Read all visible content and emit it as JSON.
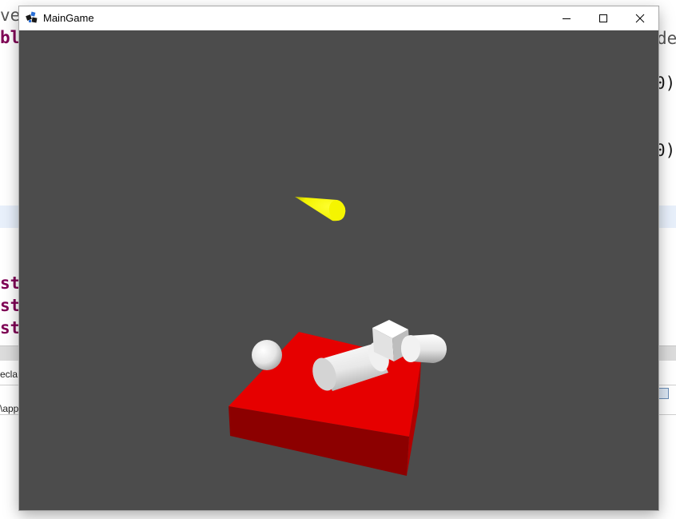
{
  "window": {
    "title": "MainGame"
  },
  "background_ide": {
    "code_fragments": [
      "ve",
      "bl",
      "st",
      "st",
      "st"
    ],
    "right_fragments": [
      "de",
      "0)",
      "0)"
    ],
    "panel_tab": "ecla",
    "path_fragment": "\\app"
  },
  "scene": {
    "background_color": "#4c4c4c",
    "objects": [
      {
        "name": "yellow-cone",
        "color": "#ffff00"
      },
      {
        "name": "red-platform",
        "color": "#e00000"
      },
      {
        "name": "white-sphere",
        "color": "#ffffff"
      },
      {
        "name": "white-cylinder",
        "color": "#ffffff"
      },
      {
        "name": "white-cube",
        "color": "#ffffff"
      },
      {
        "name": "white-capsule",
        "color": "#ffffff"
      }
    ]
  },
  "icons": {
    "app": "app-logo-icon",
    "minimize": "minimize-icon",
    "maximize": "maximize-icon",
    "close": "close-icon"
  }
}
